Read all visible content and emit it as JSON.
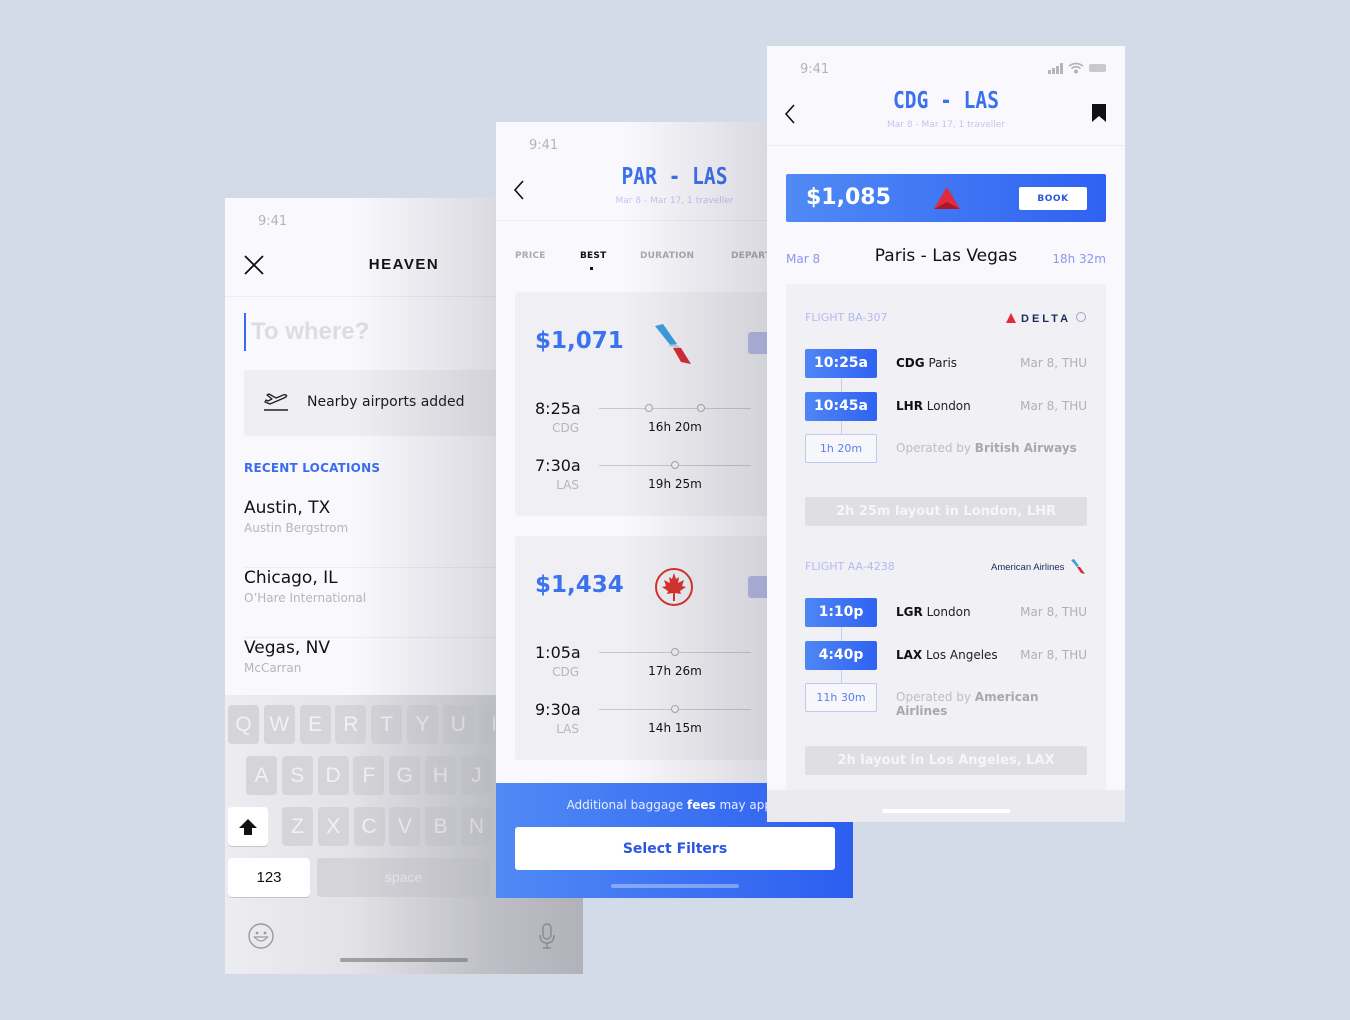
{
  "background_color": "#d4dbe8",
  "screen1": {
    "status_time": "9:41",
    "brand": "HEAVEN",
    "search_placeholder": "To where?",
    "nearby_label": "Nearby airports added",
    "recent_title": "RECENT LOCATIONS",
    "recent_locations": [
      {
        "city": "Austin, TX",
        "airport": "Austin Bergstrom"
      },
      {
        "city": "Chicago, IL",
        "airport": "O’Hare International"
      },
      {
        "city": "Vegas, NV",
        "airport": "McCarran"
      }
    ],
    "keyboard": {
      "row1": [
        "Q",
        "W",
        "E",
        "R",
        "T",
        "Y",
        "U",
        "I"
      ],
      "row2": [
        "A",
        "S",
        "D",
        "F",
        "G",
        "H",
        "J"
      ],
      "row3": [
        "Z",
        "X",
        "C",
        "V",
        "B",
        "N"
      ],
      "numbers_key": "123",
      "space_key": "space"
    },
    "accent_color": "#3b6cf0"
  },
  "screen2": {
    "status_time": "9:41",
    "route": "PAR - LAS",
    "subtitle": "Mar 8 - Mar 17, 1 traveller",
    "tabs": [
      {
        "label": "PRICE",
        "active": false
      },
      {
        "label": "BEST",
        "active": true
      },
      {
        "label": "DURATION",
        "active": false
      },
      {
        "label": "DEPART",
        "active": false
      }
    ],
    "results": [
      {
        "price": "$1,071",
        "airline": "American Airlines",
        "legs": [
          {
            "time": "8:25a",
            "code": "CDG",
            "duration": "16h 20m",
            "stops": 2
          },
          {
            "time": "7:30a",
            "code": "LAS",
            "duration": "19h 25m",
            "stops": 1
          }
        ]
      },
      {
        "price": "$1,434",
        "airline": "Air Canada",
        "legs": [
          {
            "time": "1:05a",
            "code": "CDG",
            "duration": "17h 26m",
            "stops": 1
          },
          {
            "time": "9:30a",
            "code": "LAS",
            "duration": "14h 15m",
            "stops": 1
          }
        ]
      }
    ],
    "footer_note_pre": "Additional baggage ",
    "footer_note_bold": "fees",
    "footer_note_post": " may apply",
    "filter_button": "Select Filters"
  },
  "screen3": {
    "status_time": "9:41",
    "route": "CDG - LAS",
    "subtitle": "Mar 8 - Mar 17, 1 traveller",
    "price": "$1,085",
    "book_label": "BOOK",
    "trip_date": "Mar 8",
    "trip_title": "Paris - Las Vegas",
    "trip_duration": "18h 32m",
    "flights": [
      {
        "flight_no": "FLIGHT BA-307",
        "carrier": "DELTA",
        "segments": [
          {
            "time": "10:25a",
            "code": "CDG",
            "city": "Paris",
            "date": "Mar 8, THU"
          },
          {
            "time": "10:45a",
            "code": "LHR",
            "city": "London",
            "date": "Mar 8, THU"
          }
        ],
        "duration": "1h 20m",
        "operated_prefix": "Operated by ",
        "operated_by": "British Airways",
        "layover": "2h 25m layout in London, LHR"
      },
      {
        "flight_no": "FLIGHT AA-4238",
        "carrier": "American Airlines",
        "segments": [
          {
            "time": "1:10p",
            "code": "LGR",
            "city": "London",
            "date": "Mar 8, THU"
          },
          {
            "time": "4:40p",
            "code": "LAX",
            "city": "Los Angeles",
            "date": "Mar 8, THU"
          }
        ],
        "duration": "11h 30m",
        "operated_prefix": "Operated by ",
        "operated_by": "American Airlines",
        "layover": "2h layout in Los Angeles, LAX"
      }
    ]
  }
}
